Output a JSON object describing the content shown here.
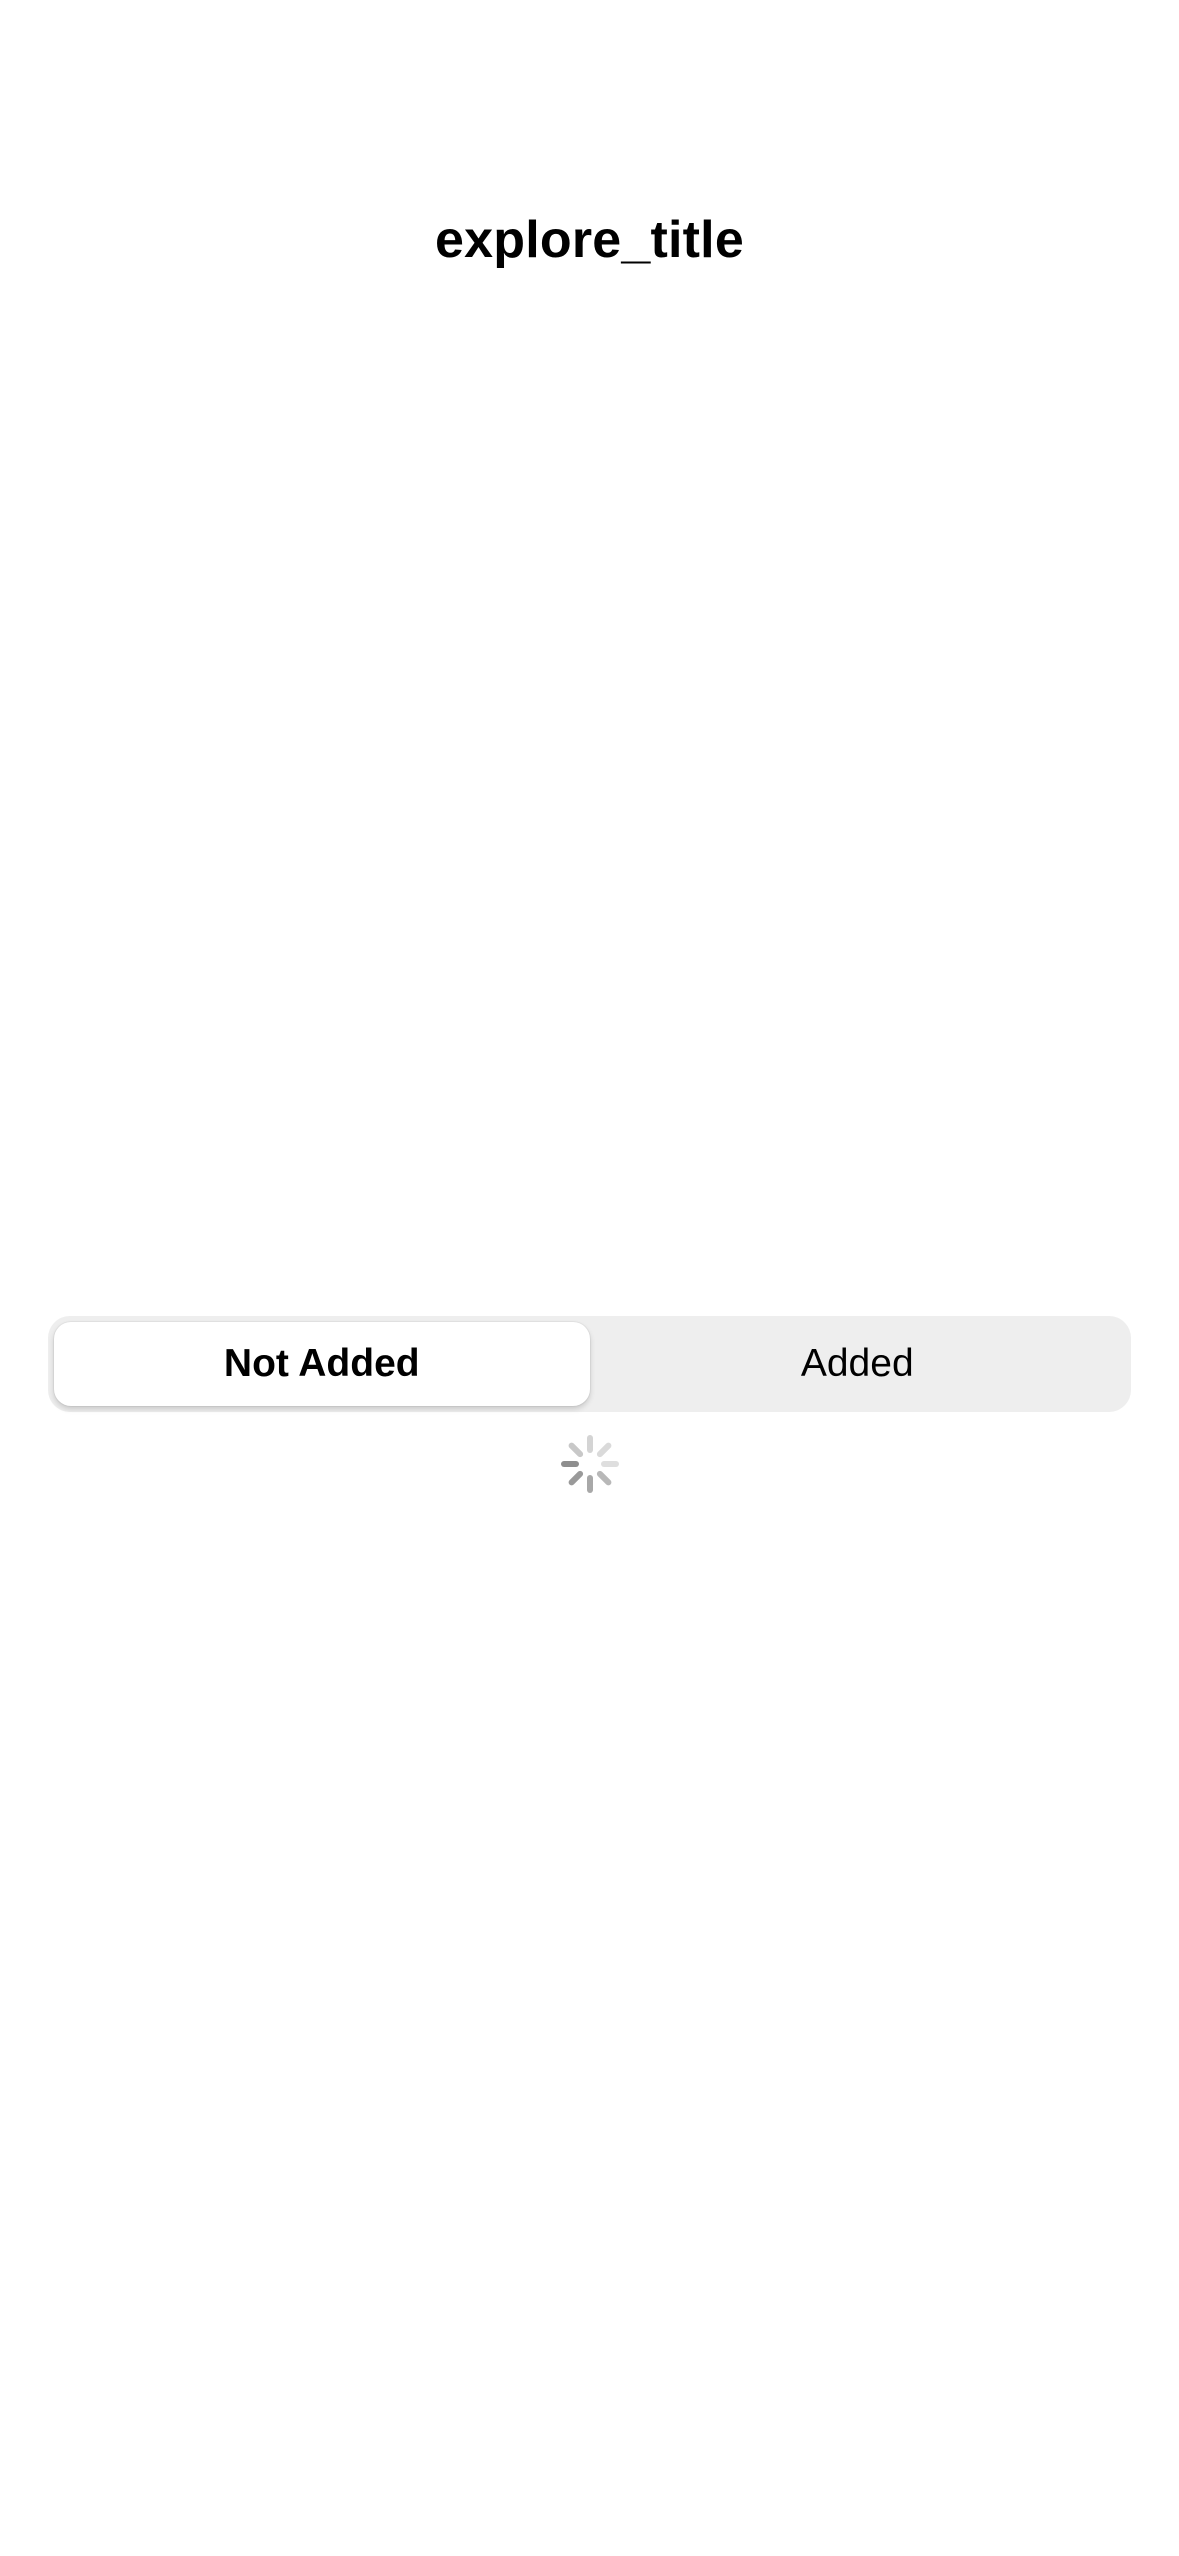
{
  "header": {
    "title": "explore_title"
  },
  "segmented_control": {
    "options": [
      {
        "label": "Not Added",
        "selected": true
      },
      {
        "label": "Added",
        "selected": false
      }
    ]
  },
  "loading": {
    "icon": "spinner-icon"
  }
}
